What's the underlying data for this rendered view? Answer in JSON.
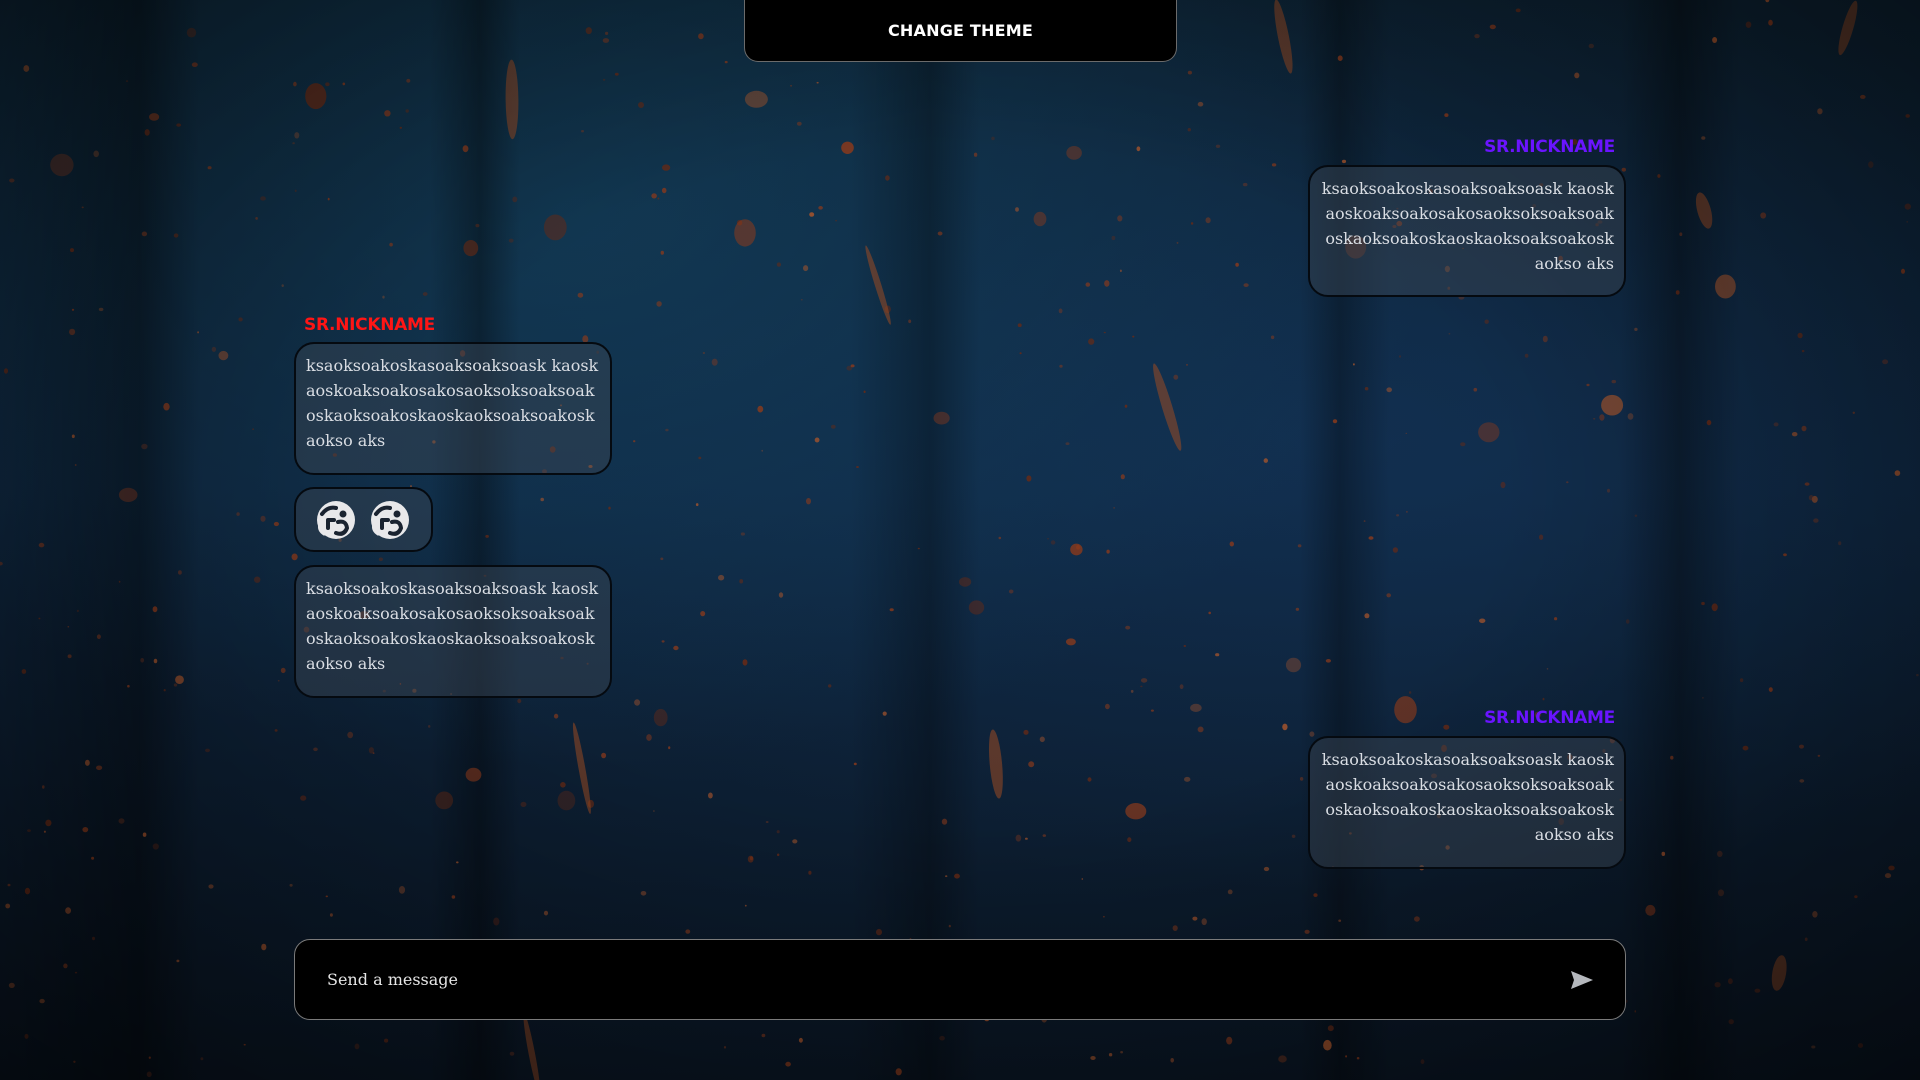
{
  "header": {
    "change_theme_label": "CHANGE THEME"
  },
  "messages": [
    {
      "side": "right",
      "nickname": "SR.NICKNAME",
      "nickname_color": "#6a14ff",
      "text": "ksaoksoakoskasoaksoaksoask kaoskaoskoaksoakosakosaoksoksoaksoak oskaoksoakoskaoskaoksoaksoakoskaokso aks"
    },
    {
      "side": "left",
      "nickname": "SR.NICKNAME",
      "nickname_color": "#ff1515",
      "text": "ksaoksoakoskasoaksoaksoask kaoskaoskoaksoakosakosaoksoksoaksoak oskaoksoakoskaoskaoksoaksoakoskaokso aks",
      "stickers": [
        "sticker-face-icon",
        "sticker-face-icon"
      ],
      "followup_text": "ksaoksoakoskasoaksoaksoask kaoskaoskoaksoakosakosaoksoksoaksoak oskaoksoakoskaoskaoksoaksoakoskaokso aks"
    },
    {
      "side": "right",
      "nickname": "SR.NICKNAME",
      "nickname_color": "#6a14ff",
      "text": "ksaoksoakoskasoaksoaksoask kaoskaoskoaksoakosakosaoksoksoaksoak oskaoksoakoskaoskaoksoaksoakoskaokso aks"
    }
  ],
  "composer": {
    "placeholder": "Send a message",
    "send_icon": "send-icon"
  },
  "colors": {
    "accent_red": "#ff1515",
    "accent_purple": "#6a14ff",
    "bubble_text": "#d9dde3"
  }
}
